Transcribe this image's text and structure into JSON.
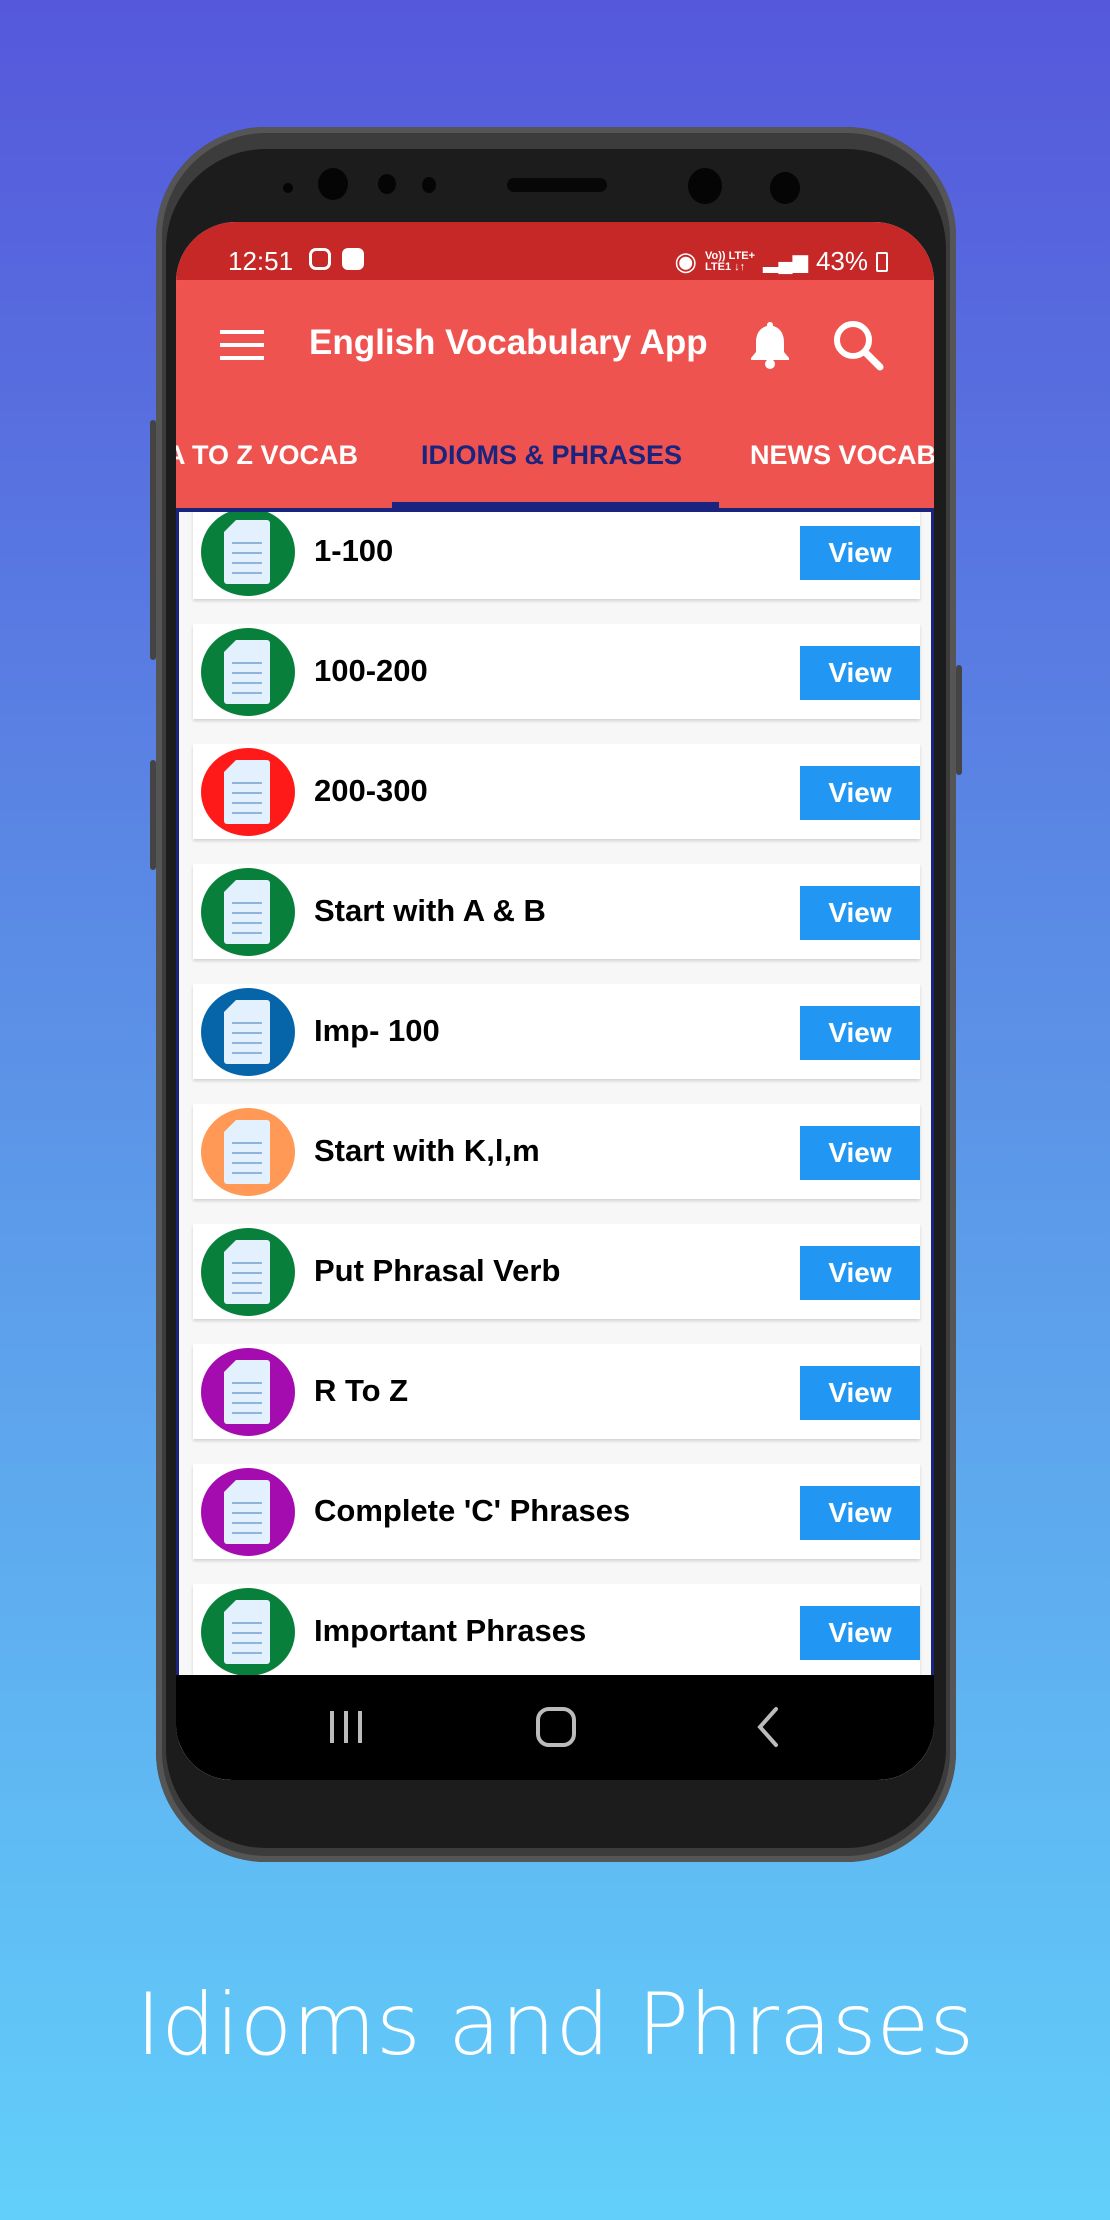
{
  "status_bar": {
    "time": "12:51",
    "network": [
      "Vo)) LTE+",
      "LTE1 ↓↑"
    ],
    "battery": "43%"
  },
  "app_bar": {
    "title": "English Vocabulary App"
  },
  "tabs": [
    {
      "label": "A TO Z VOCAB"
    },
    {
      "label": "IDIOMS & PHRASES",
      "active": true
    },
    {
      "label": "NEWS VOCAB"
    }
  ],
  "colors": {
    "status_bar": "#c62828",
    "app_bar": "#ef5350",
    "accent": "#1a237e",
    "button": "#2196f3"
  },
  "list": {
    "button_label": "View",
    "items": [
      {
        "label": "1-100",
        "color": "#087f3a"
      },
      {
        "label": "100-200",
        "color": "#087f3a"
      },
      {
        "label": "200-300",
        "color": "#ff1a1a"
      },
      {
        "label": "Start with A & B",
        "color": "#087f3a"
      },
      {
        "label": "Imp- 100",
        "color": "#0565a8"
      },
      {
        "label": "Start with K,l,m",
        "color": "#ff9955"
      },
      {
        "label": "Put Phrasal Verb",
        "color": "#087f3a"
      },
      {
        "label": "R To Z",
        "color": "#a40caf"
      },
      {
        "label": "Complete 'C' Phrases",
        "color": "#a40caf"
      },
      {
        "label": "Important Phrases",
        "color": "#087f3a"
      }
    ]
  },
  "caption": "Idioms and Phrases"
}
